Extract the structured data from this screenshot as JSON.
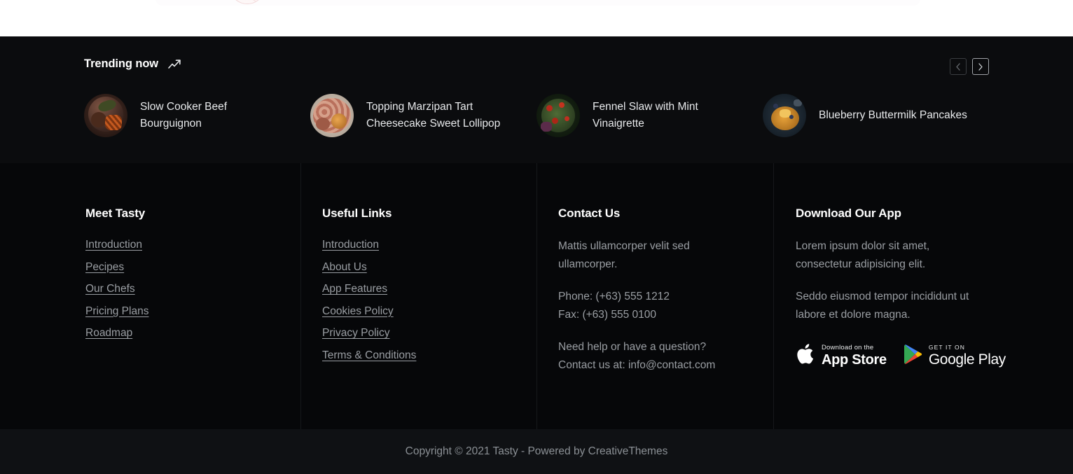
{
  "trending": {
    "title": "Trending now",
    "trend_icon": "trending-up-icon",
    "prev_label": "‹",
    "next_label": "›",
    "items": [
      {
        "title": "Slow Cooker Beef Bourguignon",
        "thumb": "beef-bourguignon-thumb"
      },
      {
        "title": "Topping Marzipan Tart Cheesecake Sweet Lollipop",
        "thumb": "marzipan-tart-thumb"
      },
      {
        "title": "Fennel Slaw with Mint Vinaigrette",
        "thumb": "fennel-slaw-thumb"
      },
      {
        "title": "Blueberry Buttermilk Pancakes",
        "thumb": "blueberry-pancakes-thumb"
      }
    ]
  },
  "footer": {
    "col1": {
      "heading": "Meet Tasty",
      "links": [
        "Introduction",
        "Pecipes",
        "Our Chefs",
        "Pricing Plans",
        "Roadmap"
      ]
    },
    "col2": {
      "heading": "Useful Links",
      "links": [
        "Introduction",
        "About Us",
        "App Features",
        "Cookies Policy",
        "Privacy Policy",
        "Terms & Conditions"
      ]
    },
    "col3": {
      "heading": "Contact Us",
      "intro": "Mattis ullamcorper velit sed ullamcorper.",
      "phone": "Phone: (+63) 555 1212",
      "fax": "Fax: (+63) 555 0100",
      "help": "Need help or have a question?",
      "email_line": "Contact us at: info@contact.com"
    },
    "col4": {
      "heading": "Download Our App",
      "para1": "Lorem ipsum dolor sit amet, consectetur adipisicing elit.",
      "para2": "Seddo eiusmod tempor incididunt ut labore et dolore magna.",
      "appstore": {
        "small": "Download on the",
        "big": "App Store",
        "icon": "apple-icon"
      },
      "googleplay": {
        "small": "GET IT ON",
        "big": "Google Play",
        "icon": "google-play-icon"
      }
    },
    "copyright": "Copyright © 2021 Tasty - Powered by CreativeThemes"
  },
  "colors": {
    "trending_bg": "#0b0c0e",
    "footer_bg": "#060709",
    "bottom_bg": "#0f1114",
    "text_primary": "#ffffff",
    "text_muted": "#9a9ea3"
  }
}
